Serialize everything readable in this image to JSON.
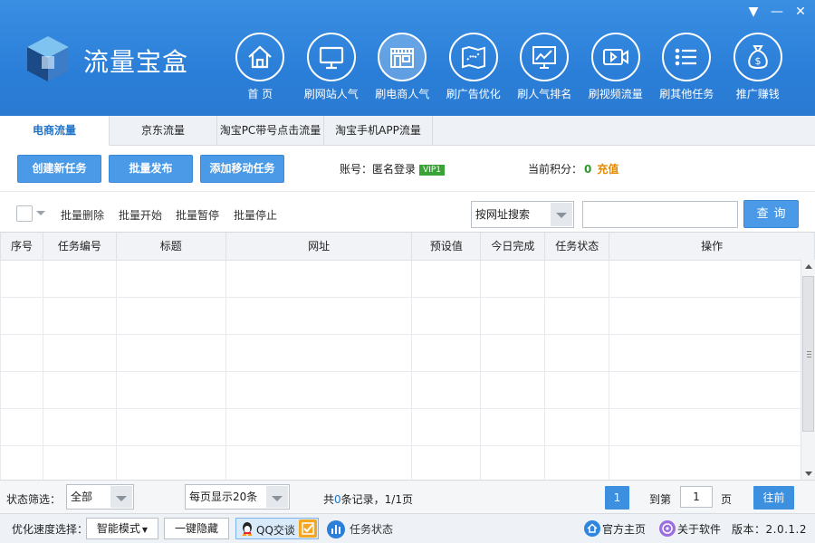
{
  "app": {
    "title": "流量宝盒"
  },
  "window": {
    "min_icon": "minimize-icon",
    "close_icon": "close-icon"
  },
  "nav": [
    {
      "label": "首 页",
      "icon": "home-icon"
    },
    {
      "label": "刷网站人气",
      "icon": "monitor-icon"
    },
    {
      "label": "刷电商人气",
      "icon": "store-icon",
      "active": true
    },
    {
      "label": "刷广告优化",
      "icon": "map-icon"
    },
    {
      "label": "刷人气排名",
      "icon": "chart-board-icon"
    },
    {
      "label": "刷视频流量",
      "icon": "video-icon"
    },
    {
      "label": "刷其他任务",
      "icon": "list-icon"
    },
    {
      "label": "推广赚钱",
      "icon": "money-bag-icon"
    }
  ],
  "tabs": [
    "电商流量",
    "京东流量",
    "淘宝PC带号点击流量",
    "淘宝手机APP流量"
  ],
  "toolbar": {
    "create_label": "创建新任务",
    "batch_label": "批量发布",
    "mobile_label": "添加移动任务",
    "account_label": "账号：",
    "account_value": "匿名登录",
    "vip": "VIP1",
    "points_label": "当前积分：",
    "points_value": "0",
    "recharge": "充值"
  },
  "actions": {
    "delete": "批量删除",
    "start": "批量开始",
    "pause": "批量暂停",
    "stop": "批量停止",
    "search_mode": "按网址搜索",
    "query": "查询"
  },
  "table": {
    "headers": [
      "序号",
      "任务编号",
      "标题",
      "网址",
      "预设值",
      "今日完成",
      "任务状态",
      "操作"
    ]
  },
  "pager": {
    "filter_label": "状态筛选：",
    "filter_value": "全部",
    "page_size": "每页显示20条",
    "records_prefix": "共",
    "records_count": "0",
    "records_suffix": "条记录，1/1页",
    "current_page": "1",
    "goto_label": "到第",
    "goto_value": "1",
    "page_unit": "页",
    "go_button": "往前"
  },
  "status": {
    "speed_label": "优化速度选择：",
    "speed_mode": "智能模式",
    "hide_button": "一键隐藏",
    "qq_label": "QQ交谈",
    "task_status": "任务状态",
    "homepage": "官方主页",
    "about": "关于软件",
    "version": "版本：2.0.1.2"
  },
  "colors": {
    "header": "#2b7fd8",
    "button": "#4a9ae8",
    "vip": "#3aa335",
    "recharge": "#e68a00"
  }
}
